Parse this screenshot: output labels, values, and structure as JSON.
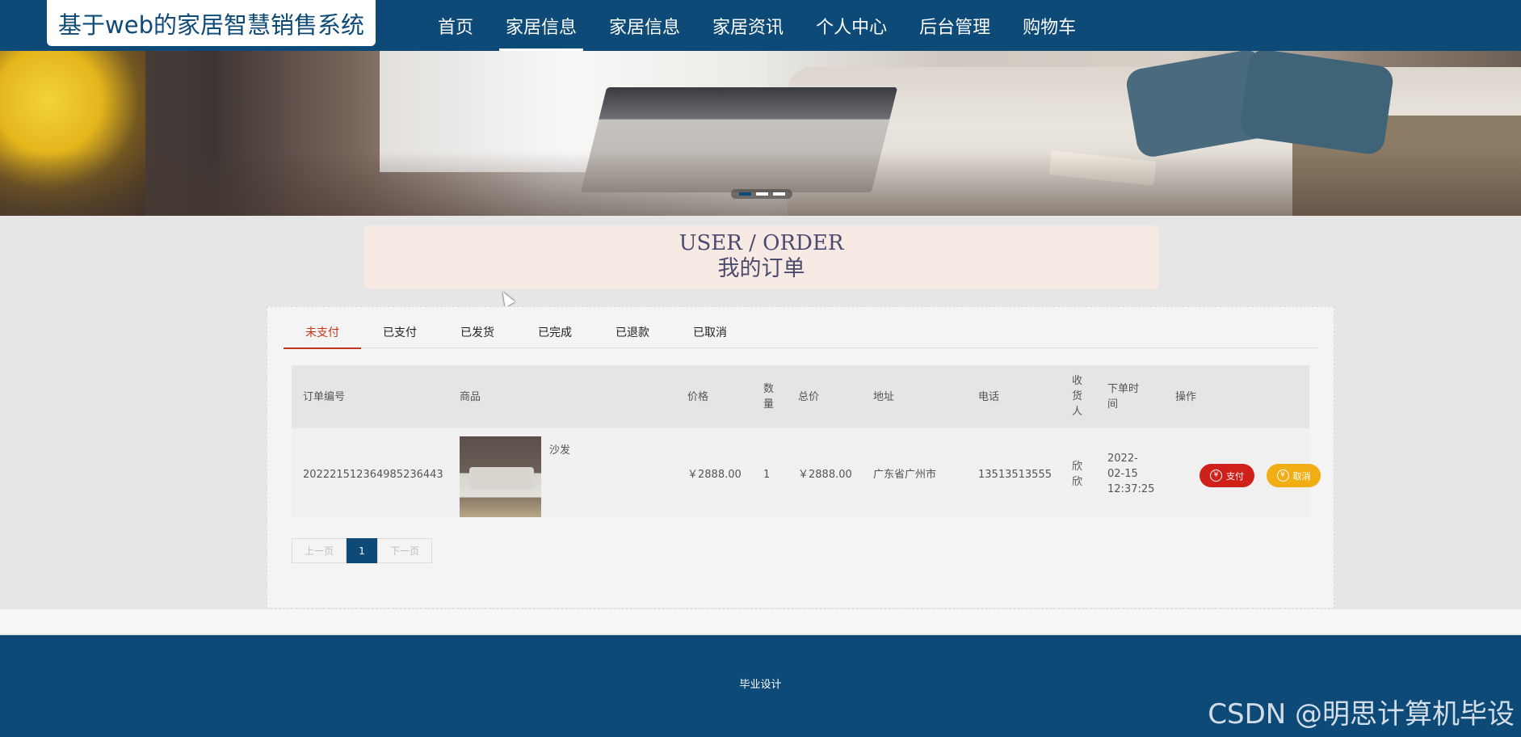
{
  "header": {
    "brand": "基于web的家居智慧销售系统",
    "nav": [
      {
        "label": "首页"
      },
      {
        "label": "家居信息"
      },
      {
        "label": "家居信息"
      },
      {
        "label": "家居资讯"
      },
      {
        "label": "个人中心"
      },
      {
        "label": "后台管理"
      },
      {
        "label": "购物车"
      }
    ],
    "active_nav": 1
  },
  "banner": {
    "slides": 3,
    "active_slide": 0
  },
  "section": {
    "title_en": "USER / ORDER",
    "title_cn": "我的订单"
  },
  "tabs": [
    {
      "label": "未支付"
    },
    {
      "label": "已支付"
    },
    {
      "label": "已发货"
    },
    {
      "label": "已完成"
    },
    {
      "label": "已退款"
    },
    {
      "label": "已取消"
    }
  ],
  "active_tab": 0,
  "table": {
    "headers": {
      "order_no": "订单编号",
      "goods": "商品",
      "price": "价格",
      "qty": "数\n量",
      "total": "总价",
      "address": "地址",
      "phone": "电话",
      "receiver": "收\n货\n人",
      "time": "下单时\n间",
      "action": "操作"
    },
    "rows": [
      {
        "order_no": "202221512364985236443",
        "goods_name": "沙发",
        "price": "￥2888.00",
        "qty": "1",
        "total": "￥2888.00",
        "address": "广东省广州市",
        "phone": "13513513555",
        "receiver": "欣\n欣",
        "time": "2022-\n02-15\n12:37:25",
        "pay_label": "支付",
        "cancel_label": "取消"
      }
    ]
  },
  "pagination": {
    "prev": "上一页",
    "current": "1",
    "next": "下一页"
  },
  "footer": {
    "text": "毕业设计"
  },
  "watermark": "CSDN @明思计算机毕设",
  "colors": {
    "primary": "#0d4a78",
    "active_tab": "#c1361c",
    "pay": "#d0201a",
    "cancel": "#f0ad14"
  }
}
